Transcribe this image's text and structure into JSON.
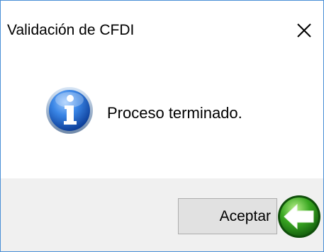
{
  "window": {
    "title": "Validación de CFDI",
    "close_icon": "close-icon"
  },
  "message": {
    "icon": "info-icon",
    "text": "Proceso terminado."
  },
  "footer": {
    "ok_label": "Aceptar",
    "ok_icon": "green-back-arrow-icon"
  },
  "colors": {
    "window_border": "#4a8fd6",
    "footer_bg": "#f0f0f0",
    "button_bg": "#e1e1e1",
    "info_blue": "#2a6fd0",
    "arrow_green": "#3aa822"
  }
}
